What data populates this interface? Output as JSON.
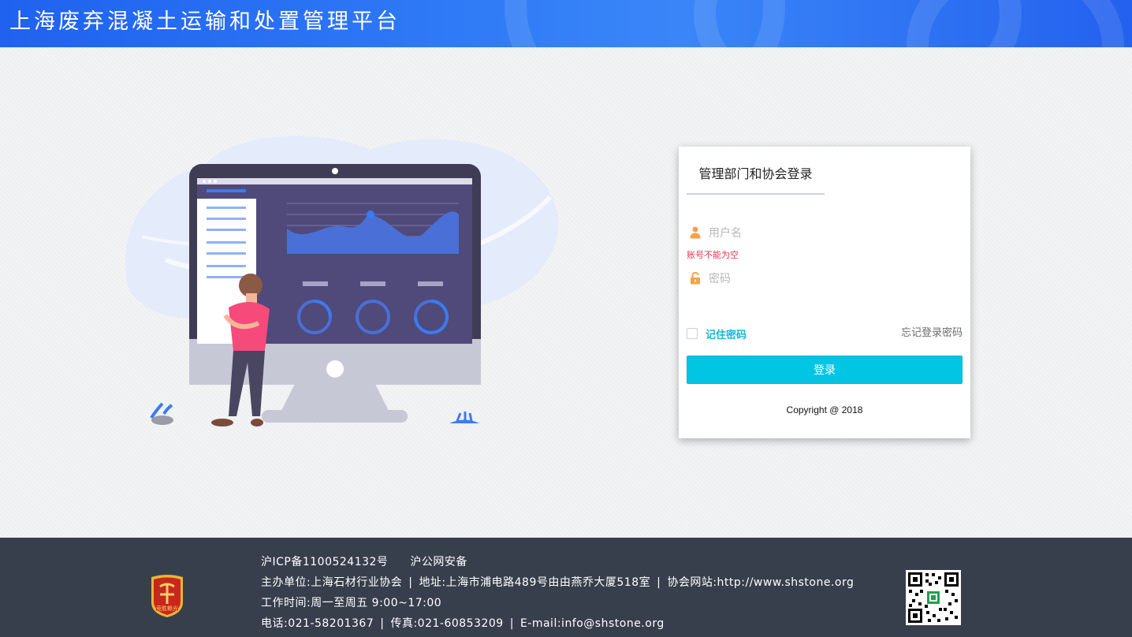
{
  "header": {
    "title": "上海废弃混凝土运输和处置管理平台"
  },
  "login": {
    "title": "管理部门和协会登录",
    "username_placeholder": "用户名",
    "username_error": "账号不能为空",
    "password_placeholder": "密码",
    "remember_label": "记住密码",
    "forgot_label": "忘记登录密码",
    "submit_label": "登录",
    "copyright": "Copyright @ 2018"
  },
  "footer": {
    "icp": "沪ICP备1100524132号",
    "police": "沪公网安备",
    "host": "主办单位:上海石材行业协会",
    "address": "地址:上海市浦电路489号由由燕乔大厦518室",
    "website": "协会网站:http://www.shstone.org",
    "hours": "工作时间:周一至周五 9:00~17:00",
    "phone": "电话:021-58201367",
    "fax": "传真:021-60853209",
    "email": "E-mail:info@shstone.org",
    "separator": "|",
    "logo_text": "竞胜赖光"
  },
  "colors": {
    "header_blue": "#2f7af6",
    "accent_cyan": "#00c6e3",
    "error_red": "#e8374e",
    "icon_orange": "#f5a14b",
    "footer_bg": "#373f4c"
  },
  "icons": [
    "user-icon",
    "lock-icon",
    "checkbox",
    "qr-code",
    "association-logo"
  ]
}
